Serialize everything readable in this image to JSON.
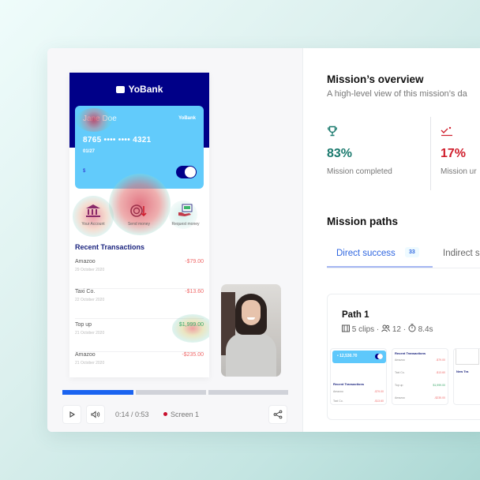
{
  "player": {
    "phone": {
      "brand": "YoBank",
      "card": {
        "holder": "Jane Doe",
        "brand": "YoBank",
        "number": "8765 •••• •••• 4321",
        "expiry": "01/27",
        "currency": "$"
      },
      "actions": [
        {
          "label": "Your Account",
          "icon": "bank-icon"
        },
        {
          "label": "Send money",
          "icon": "send-money-icon"
        },
        {
          "label": "Request money",
          "icon": "request-money-icon"
        }
      ],
      "recent_title": "Recent Transactions",
      "transactions": [
        {
          "name": "Amazoo",
          "date": "29 October 2020",
          "amount": "-$79.00",
          "type": "debit"
        },
        {
          "name": "Taxi Co.",
          "date": "22 October 2020",
          "amount": "-$13.60",
          "type": "debit"
        },
        {
          "name": "Top up",
          "date": "21 October 2020",
          "amount": "$1,999.00",
          "type": "credit"
        },
        {
          "name": "Amazoo",
          "date": "21 October 2020",
          "amount": "-$235.00",
          "type": "debit"
        }
      ]
    },
    "progress_segments": [
      1.0,
      0.0,
      0.0
    ],
    "time": "0:14 / 0:53",
    "screen_label": "Screen 1",
    "colors": {
      "accent": "#1a63f0",
      "rec": "#c8102e",
      "bank_navy": "#000088",
      "card_blue": "#62cbfb"
    }
  },
  "overview": {
    "title": "Mission’s overview",
    "subtitle": "A high-level view of this mission’s da",
    "stats": [
      {
        "icon": "trophy-icon",
        "value": "83%",
        "label": "Mission completed",
        "color": "#1b7a6e"
      },
      {
        "icon": "unfinished-icon",
        "value": "17%",
        "label": "Mission ur",
        "color": "#d0202e"
      }
    ]
  },
  "paths": {
    "title": "Mission paths",
    "tabs": [
      {
        "label": "Direct success",
        "count": "33",
        "active": true
      },
      {
        "label": "Indirect s",
        "active": false
      }
    ],
    "card": {
      "title": "Path 1",
      "clips": "5 clips",
      "users": "12",
      "duration": "8.4s",
      "thumbs": {
        "balance": "• 12,530.70",
        "recent_title": "Recent Transactions",
        "rows": [
          {
            "name": "Amazoo",
            "amount": "-$79.00"
          },
          {
            "name": "Taxi Co.",
            "amount": "-$13.60"
          },
          {
            "name": "Top up",
            "amount": "$1,999.00"
          },
          {
            "name": "Amazoo",
            "amount": "-$235.00"
          }
        ],
        "third_label": "New Tra"
      }
    }
  }
}
